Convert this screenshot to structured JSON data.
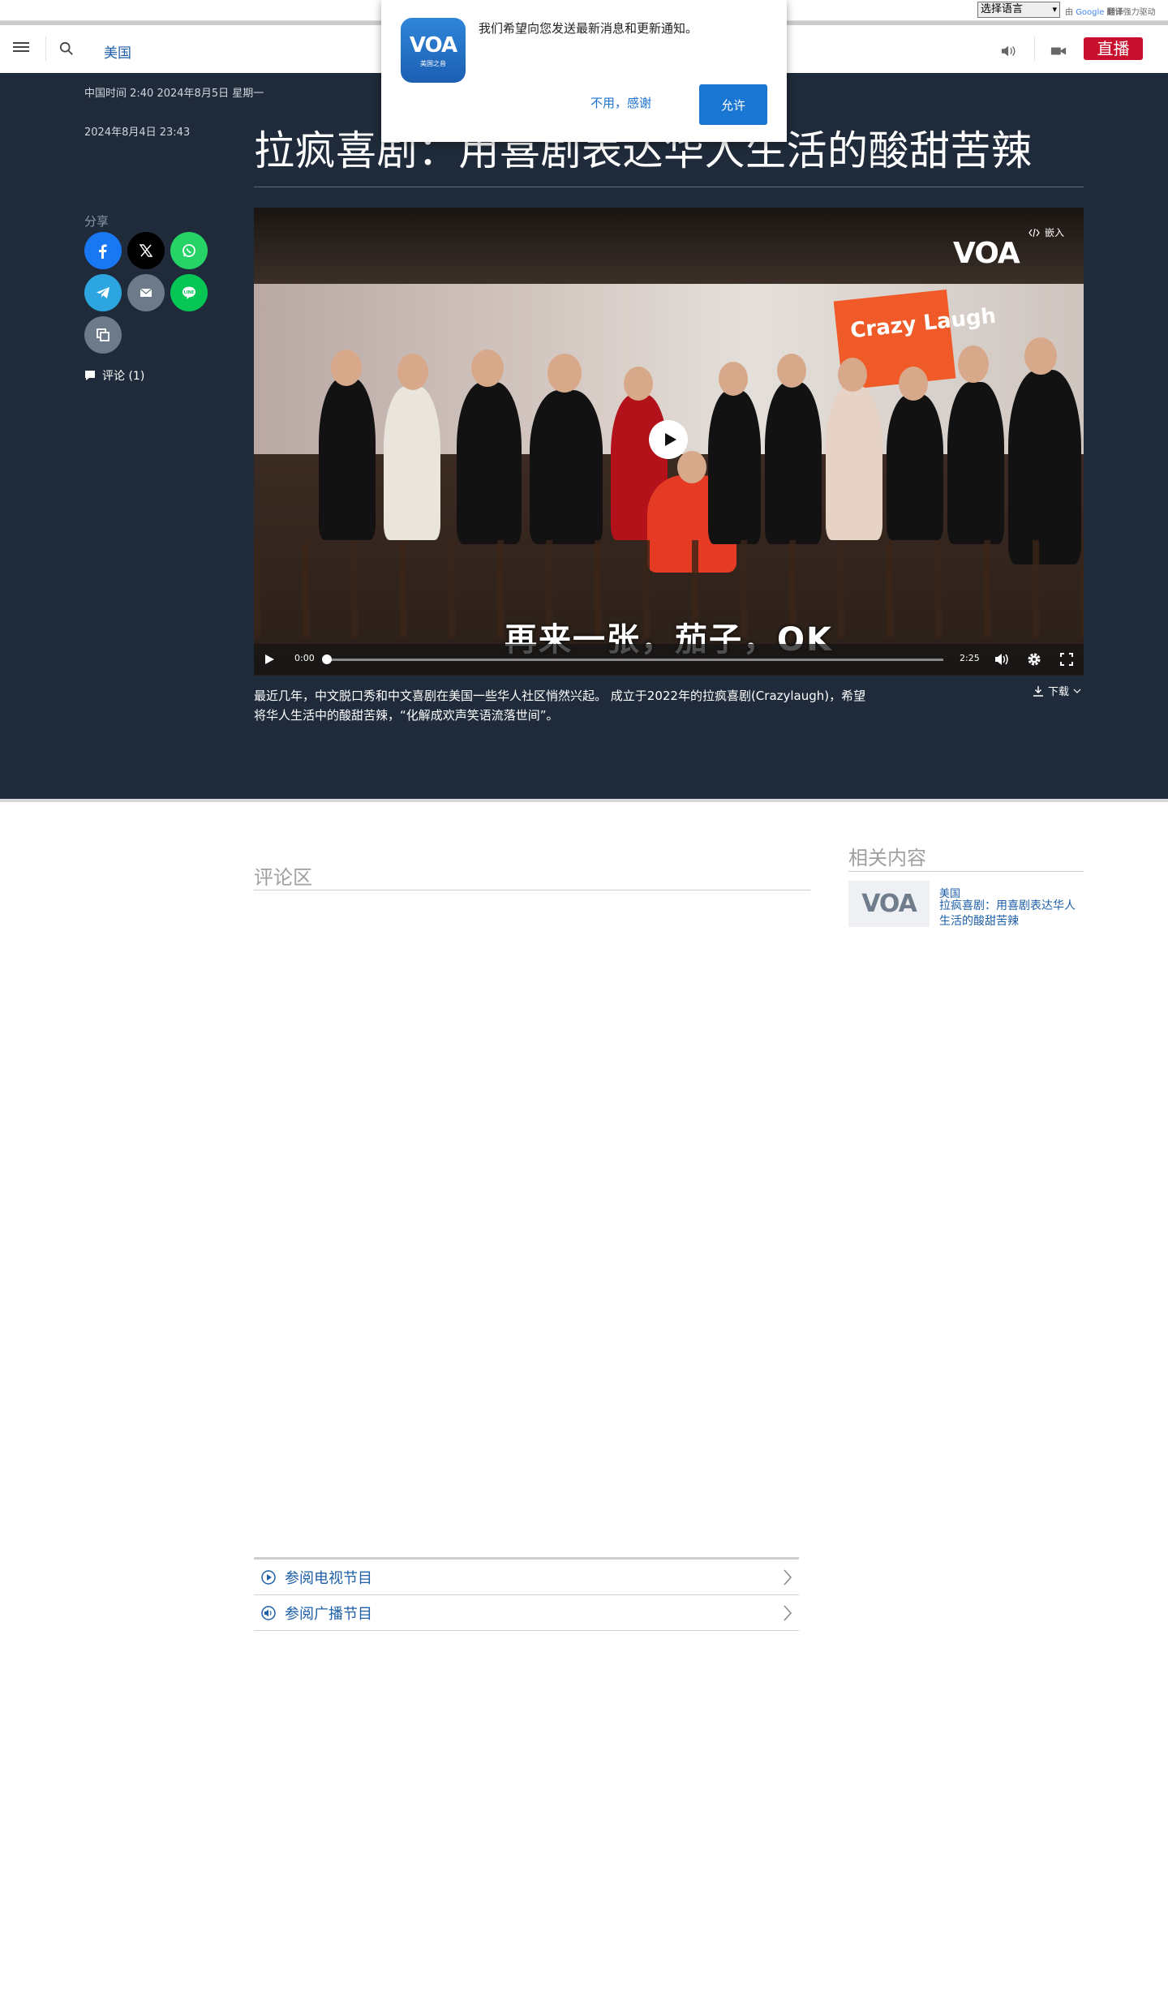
{
  "translate": {
    "select_label": "选择语言",
    "powered_prefix": "由",
    "google": "Google",
    "translate_word": "翻译",
    "powered_suffix": "强力驱动"
  },
  "header": {
    "section": "美国",
    "live_label": "直播"
  },
  "notification": {
    "message": "我们希望向您发送最新消息和更新通知。",
    "logo_text": "VOA",
    "logo_sub": "美国之音",
    "decline_label": "不用，感谢",
    "allow_label": "允许"
  },
  "article": {
    "clock": "中国时间 2:40 2024年8月5日 星期一",
    "published": "2024年8月4日 23:43",
    "headline": "拉疯喜剧：用喜剧表达华人生活的酸甜苦辣",
    "share_label": "分享",
    "comments_link": "评论 (1)",
    "caption": "最近几年，中文脱口秀和中文喜剧在美国一些华人社区悄然兴起。 成立于2022年的拉疯喜剧(Crazylaugh)，希望将华人生活中的酸甜苦辣，“化解成欢声笑语流落世间”。",
    "download_label": "下载"
  },
  "video": {
    "watermark": "VOA",
    "embed_label": "嵌入",
    "banner_text": "Crazy Laugh",
    "subtitle": "再来一张，茄子，OK",
    "current_time": "0:00",
    "duration": "2:25",
    "progress": 0
  },
  "comments": {
    "title": "评论区"
  },
  "related": {
    "title": "相关内容",
    "thumb_text": "VOA",
    "items": [
      {
        "category": "美国",
        "headline": "拉疯喜剧：用喜剧表达华人生活的酸甜苦辣"
      }
    ]
  },
  "schedule": {
    "tv_label": "参阅电视节目",
    "radio_label": "参阅广播节目"
  },
  "colors": {
    "dark_bg": "#1f2b3a",
    "accent_link": "#1e5fa8",
    "live_red": "#c8102e",
    "allow_blue": "#1976d2"
  }
}
